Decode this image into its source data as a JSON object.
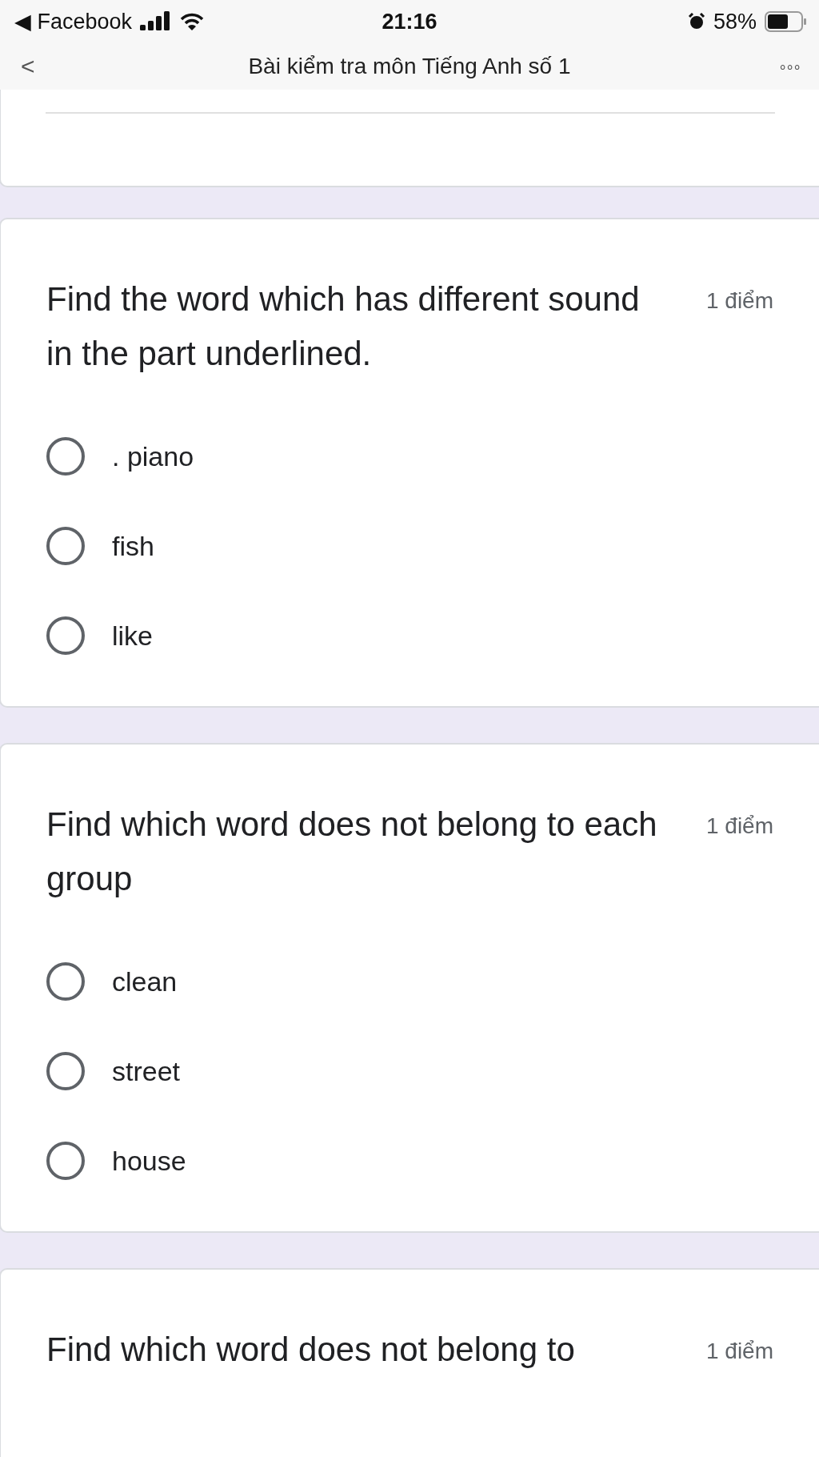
{
  "status_bar": {
    "back_app": "◀ Facebook",
    "time": "21:16",
    "battery": "58%"
  },
  "nav": {
    "back": "<",
    "title": "Bài kiểm tra môn Tiếng Anh số 1",
    "more": "∘∘∘"
  },
  "questions": [
    {
      "text": "Find the word which has different sound in the part underlined.",
      "points": "1 điểm",
      "options": [
        {
          "label": ". piano",
          "selected": false
        },
        {
          "label": "fish",
          "selected": false
        },
        {
          "label": "like",
          "selected": false
        }
      ]
    },
    {
      "text": "Find which word does not belong to each group",
      "points": "1 điểm",
      "options": [
        {
          "label": "clean",
          "selected": false
        },
        {
          "label": "street",
          "selected": false
        },
        {
          "label": "house",
          "selected": false
        }
      ]
    },
    {
      "text": "Find which word does not belong to",
      "points": "1 điểm"
    }
  ]
}
